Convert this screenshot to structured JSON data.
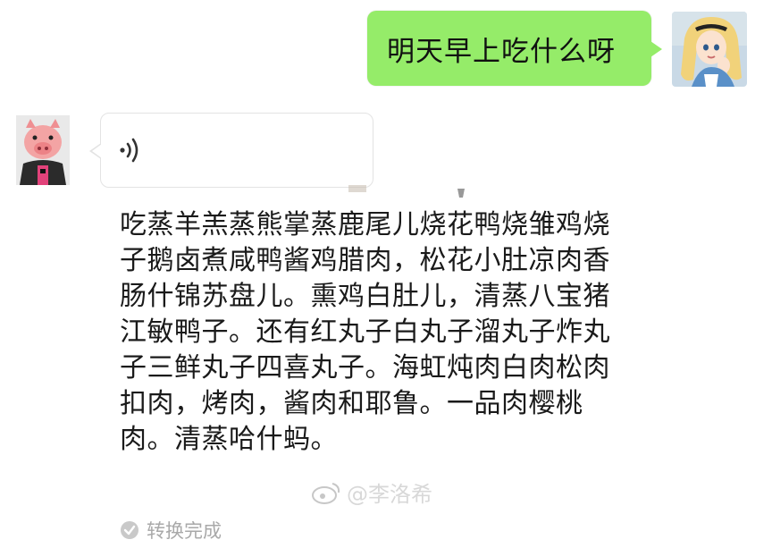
{
  "conversation": {
    "outgoing_message": {
      "text": "明天早上吃什么呀",
      "bubble_color": "#95ec69"
    },
    "incoming_voice": {
      "icon": "voice-wave-icon"
    },
    "transcription": {
      "text": "吃蒸羊羔蒸熊掌蒸鹿尾儿烧花鸭烧雏鸡烧子鹅卤煮咸鸭酱鸡腊肉，松花小肚凉肉香肠什锦苏盘儿。熏鸡白肚儿，清蒸八宝猪江敏鸭子。还有红丸子白丸子溜丸子炸丸子三鲜丸子四喜丸子。海虹炖肉白肉松肉扣肉，烤肉，酱肉和耶鲁。一品肉樱桃肉。清蒸哈什蚂。",
      "status": "转换完成",
      "status_icon": "check-circle-icon"
    },
    "watermark": {
      "text": "@李洛希",
      "icon": "weibo-icon"
    }
  },
  "colors": {
    "outgoing_bubble": "#95ec69",
    "incoming_bubble": "#ffffff",
    "muted_text": "#a9a9a9"
  }
}
